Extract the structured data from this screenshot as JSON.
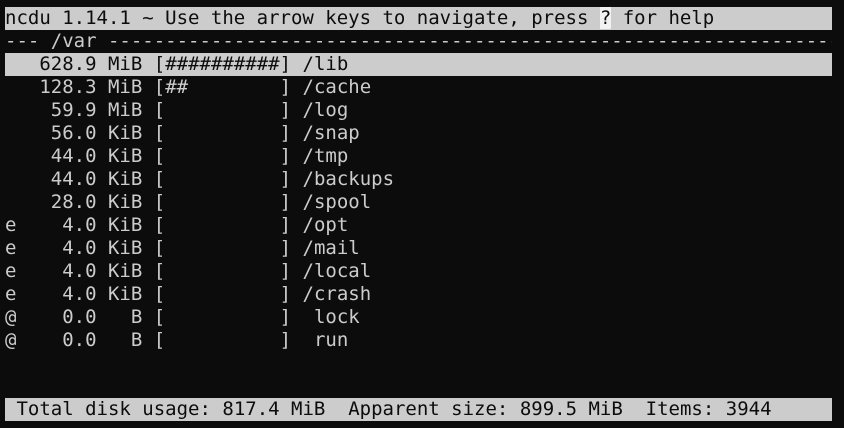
{
  "header": {
    "title_prefix": "ncdu 1.14.1 ~ Use the arrow keys to navigate, press ",
    "help_key": "?",
    "title_suffix": " for help"
  },
  "path": {
    "line": "--- /var -----------------------------------------------------------------------"
  },
  "entries": [
    {
      "flag": " ",
      "size": "628.9",
      "unit": "MiB",
      "bar": "##########",
      "name": "/lib",
      "selected": true
    },
    {
      "flag": " ",
      "size": "128.3",
      "unit": "MiB",
      "bar": "##        ",
      "name": "/cache"
    },
    {
      "flag": " ",
      "size": "59.9",
      "unit": "MiB",
      "bar": "          ",
      "name": "/log"
    },
    {
      "flag": " ",
      "size": "56.0",
      "unit": "KiB",
      "bar": "          ",
      "name": "/snap"
    },
    {
      "flag": " ",
      "size": "44.0",
      "unit": "KiB",
      "bar": "          ",
      "name": "/tmp"
    },
    {
      "flag": " ",
      "size": "44.0",
      "unit": "KiB",
      "bar": "          ",
      "name": "/backups"
    },
    {
      "flag": " ",
      "size": "28.0",
      "unit": "KiB",
      "bar": "          ",
      "name": "/spool"
    },
    {
      "flag": "e",
      "size": "4.0",
      "unit": "KiB",
      "bar": "          ",
      "name": "/opt"
    },
    {
      "flag": "e",
      "size": "4.0",
      "unit": "KiB",
      "bar": "          ",
      "name": "/mail"
    },
    {
      "flag": "e",
      "size": "4.0",
      "unit": "KiB",
      "bar": "          ",
      "name": "/local"
    },
    {
      "flag": "e",
      "size": "4.0",
      "unit": "KiB",
      "bar": "          ",
      "name": "/crash"
    },
    {
      "flag": "@",
      "size": "0.0",
      "unit": "  B",
      "bar": "          ",
      "name": " lock"
    },
    {
      "flag": "@",
      "size": "0.0",
      "unit": "  B",
      "bar": "          ",
      "name": " run"
    }
  ],
  "status": {
    "total_label": "Total disk usage:",
    "total_value": "817.4 MiB",
    "apparent_label": "Apparent size:",
    "apparent_value": "899.5 MiB",
    "items_label": "Items:",
    "items_value": "3944"
  },
  "colors": {
    "background": "#0c0c0c",
    "foreground": "#cccccc",
    "highlight": "#cccccc"
  }
}
